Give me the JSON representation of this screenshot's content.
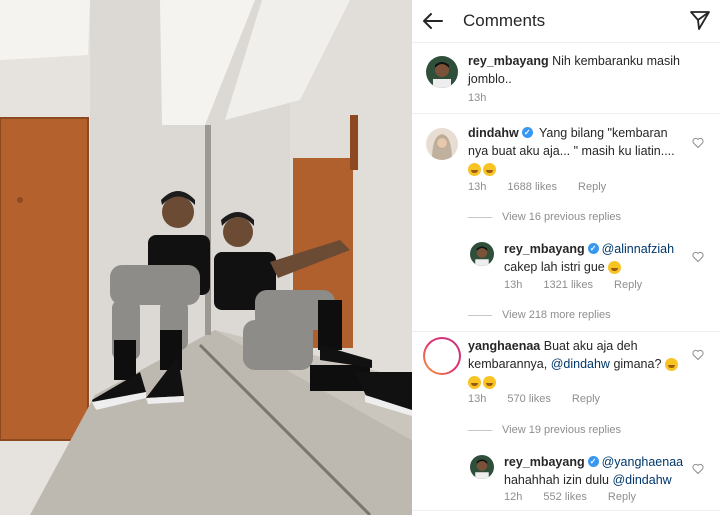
{
  "header": {
    "title": "Comments"
  },
  "comments": [
    {
      "username": "rey_mbayang",
      "text": "Nih kembaranku masih jomblo..",
      "time": "13h"
    },
    {
      "username": "dindahw",
      "text": "Yang bilang \"kembaran nya buat aku aja... \" masih ku liatin....",
      "time": "13h",
      "likes": "1688 likes",
      "reply": "Reply",
      "emoji_count": 2
    },
    {
      "view_replies": "View 16 previous replies"
    },
    {
      "username": "rey_mbayang",
      "mention": "@alinnafziah",
      "text": "cakep lah istri gue",
      "time": "13h",
      "likes": "1321 likes",
      "reply": "Reply"
    },
    {
      "view_replies": "View 218 more replies"
    },
    {
      "username": "yanghaenaa",
      "text_before": "Buat aku aja deh kembarannya,",
      "mention": "@dindahw",
      "text_after": "gimana?",
      "time": "13h",
      "likes": "570 likes",
      "reply": "Reply"
    },
    {
      "view_replies": "View 19 previous replies"
    },
    {
      "username": "rey_mbayang",
      "mention": "@yanghaenaa",
      "text": "hahahhah izin dulu",
      "mention2": "@dindahw",
      "time": "12h",
      "likes": "552 likes",
      "reply": "Reply"
    }
  ],
  "icons": {
    "back": "arrow-left-icon",
    "send": "paper-plane-icon",
    "like": "heart-outline-icon",
    "verified": "verified-badge-icon"
  },
  "colors": {
    "mention": "#00376b",
    "verified": "#3897f0",
    "meta": "#8e8e8e"
  }
}
